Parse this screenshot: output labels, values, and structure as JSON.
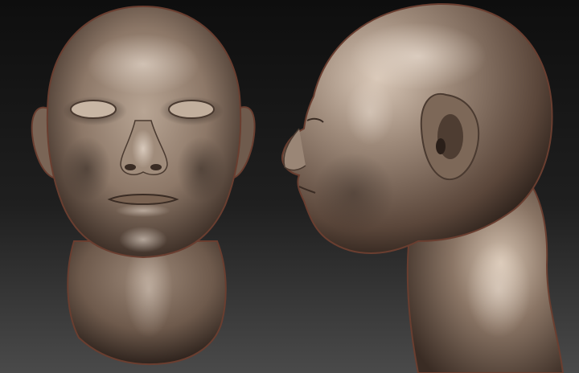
{
  "scene": {
    "kind": "3d-sculpt-render",
    "subject": "bald male head",
    "views": [
      {
        "id": "front",
        "label": ""
      },
      {
        "id": "side",
        "label": ""
      }
    ],
    "colors": {
      "background_top": "#0e0e0e",
      "background_bottom": "#4a4a4a",
      "clay_light": "#d9c8b8",
      "clay_mid": "#8d7868",
      "clay_dark": "#3a2c24",
      "rim": "#7a4a3a"
    }
  }
}
